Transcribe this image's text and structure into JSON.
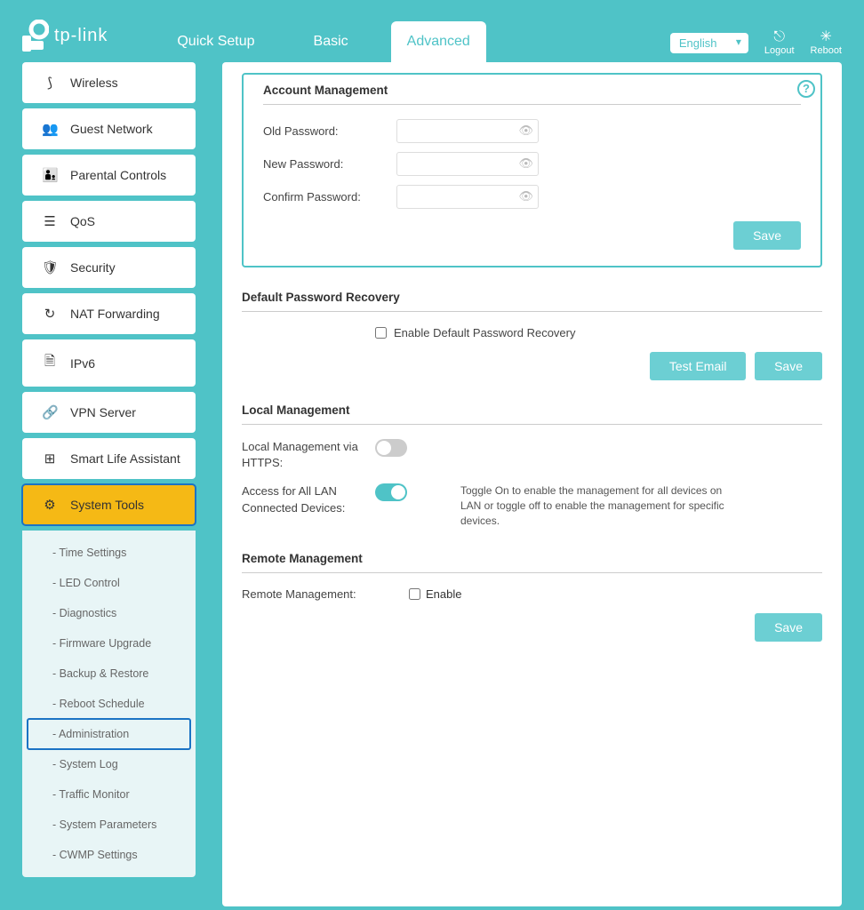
{
  "header": {
    "brand": "tp-link",
    "tabs": {
      "quick": "Quick Setup",
      "basic": "Basic",
      "advanced": "Advanced"
    },
    "lang": "English",
    "logout": "Logout",
    "reboot": "Reboot"
  },
  "sidebar": {
    "items": [
      {
        "label": "Wireless"
      },
      {
        "label": "Guest Network"
      },
      {
        "label": "Parental Controls"
      },
      {
        "label": "QoS"
      },
      {
        "label": "Security"
      },
      {
        "label": "NAT Forwarding"
      },
      {
        "label": "IPv6"
      },
      {
        "label": "VPN Server"
      },
      {
        "label": "Smart Life Assistant"
      },
      {
        "label": "System Tools"
      }
    ],
    "sub": [
      "Time Settings",
      "LED Control",
      "Diagnostics",
      "Firmware Upgrade",
      "Backup & Restore",
      "Reboot Schedule",
      "Administration",
      "System Log",
      "Traffic Monitor",
      "System Parameters",
      "CWMP Settings"
    ]
  },
  "sections": {
    "account": {
      "title": "Account Management",
      "old_pw": "Old Password:",
      "new_pw": "New Password:",
      "confirm_pw": "Confirm Password:",
      "save": "Save"
    },
    "recovery": {
      "title": "Default Password Recovery",
      "checkbox": "Enable Default Password Recovery",
      "test": "Test Email",
      "save": "Save"
    },
    "local": {
      "title": "Local Management",
      "https": "Local Management via HTTPS:",
      "all_lan": "Access for All LAN Connected Devices:",
      "desc": "Toggle On to enable the management for all devices on LAN or toggle off to enable the management for specific devices."
    },
    "remote": {
      "title": "Remote Management",
      "label": "Remote Management:",
      "enable": "Enable",
      "save": "Save"
    }
  }
}
